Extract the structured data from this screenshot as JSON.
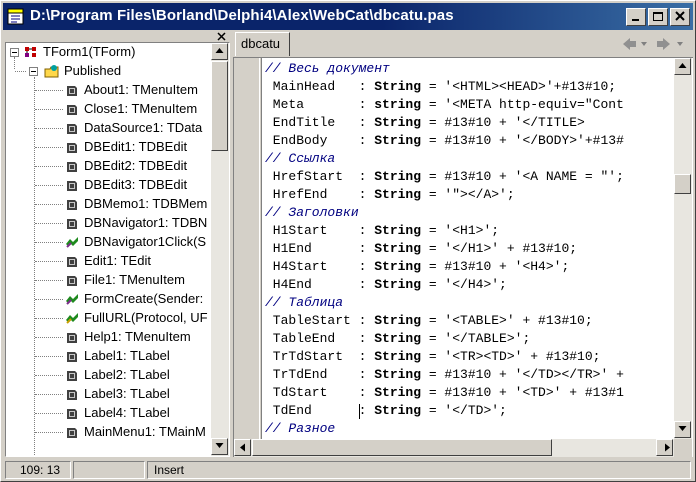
{
  "window": {
    "title": "D:\\Program Files\\Borland\\Delphi4\\Alex\\WebCat\\dbcatu.pas"
  },
  "tree": {
    "root": "TForm1(TForm)",
    "group": "Published",
    "items": [
      {
        "label": "About1: TMenuItem",
        "icon": "field-icon"
      },
      {
        "label": "Close1: TMenuItem",
        "icon": "field-icon"
      },
      {
        "label": "DataSource1: TData",
        "icon": "field-icon"
      },
      {
        "label": "DBEdit1: TDBEdit",
        "icon": "field-icon"
      },
      {
        "label": "DBEdit2: TDBEdit",
        "icon": "field-icon"
      },
      {
        "label": "DBEdit3: TDBEdit",
        "icon": "field-icon"
      },
      {
        "label": "DBMemo1: TDBMem",
        "icon": "field-icon"
      },
      {
        "label": "DBNavigator1: TDBN",
        "icon": "field-icon"
      },
      {
        "label": "DBNavigator1Click(S",
        "icon": "method-icon"
      },
      {
        "label": "Edit1: TEdit",
        "icon": "field-icon"
      },
      {
        "label": "File1: TMenuItem",
        "icon": "field-icon"
      },
      {
        "label": "FormCreate(Sender:",
        "icon": "method-icon"
      },
      {
        "label": "FullURL(Protocol, UF",
        "icon": "function-icon"
      },
      {
        "label": "Help1: TMenuItem",
        "icon": "field-icon"
      },
      {
        "label": "Label1: TLabel",
        "icon": "field-icon"
      },
      {
        "label": "Label2: TLabel",
        "icon": "field-icon"
      },
      {
        "label": "Label3: TLabel",
        "icon": "field-icon"
      },
      {
        "label": "Label4: TLabel",
        "icon": "field-icon"
      },
      {
        "label": "MainMenu1: TMainM",
        "icon": "field-icon"
      }
    ]
  },
  "editor": {
    "tab": "dbcatu",
    "lines": [
      {
        "kind": "comment",
        "text": "// Весь документ"
      },
      {
        "kind": "decl",
        "name": "MainHead  ",
        "kw": "String",
        "value": " = '<HTML><HEAD>'+#13#10;"
      },
      {
        "kind": "decl",
        "name": "Meta      ",
        "kw": "string",
        "value": " = '<META http-equiv=\"Cont"
      },
      {
        "kind": "decl",
        "name": "EndTitle  ",
        "kw": "String",
        "value": " = #13#10 + '</TITLE>"
      },
      {
        "kind": "decl",
        "name": "EndBody   ",
        "kw": "String",
        "value": " = #13#10 + '</BODY>'+#13#"
      },
      {
        "kind": "comment",
        "text": "// Ссылка"
      },
      {
        "kind": "decl",
        "name": "HrefStart ",
        "kw": "String",
        "value": " = #13#10 + '<A NAME = \"';"
      },
      {
        "kind": "decl",
        "name": "HrefEnd   ",
        "kw": "String",
        "value": " = '\"></A>';"
      },
      {
        "kind": "comment",
        "text": "// Заголовки"
      },
      {
        "kind": "decl",
        "name": "H1Start   ",
        "kw": "String",
        "value": " = '<H1>';"
      },
      {
        "kind": "decl",
        "name": "H1End     ",
        "kw": "String",
        "value": " = '</H1>' + #13#10;"
      },
      {
        "kind": "decl",
        "name": "H4Start   ",
        "kw": "String",
        "value": " = #13#10 + '<H4>';"
      },
      {
        "kind": "decl",
        "name": "H4End     ",
        "kw": "String",
        "value": " = '</H4>';"
      },
      {
        "kind": "comment",
        "text": "// Таблица"
      },
      {
        "kind": "decl",
        "name": "TableStart",
        "kw": "String",
        "value": " = '<TABLE>' + #13#10;"
      },
      {
        "kind": "decl",
        "name": "TableEnd  ",
        "kw": "String",
        "value": " = '</TABLE>';"
      },
      {
        "kind": "decl",
        "name": "TrTdStart ",
        "kw": "String",
        "value": " = '<TR><TD>' + #13#10;"
      },
      {
        "kind": "decl",
        "name": "TrTdEnd   ",
        "kw": "String",
        "value": " = #13#10 + '</TD></TR>' +"
      },
      {
        "kind": "decl",
        "name": "TdStart   ",
        "kw": "String",
        "value": " = #13#10 + '<TD>' + #13#1"
      },
      {
        "kind": "decl",
        "name": "TdEnd     ",
        "kw": "String",
        "value": " = '</TD>';"
      },
      {
        "kind": "comment",
        "text": "// Разное"
      }
    ]
  },
  "status": {
    "position": "109: 13",
    "modified": "",
    "mode": "Insert"
  },
  "colors": {
    "titlebar": "#0a246a",
    "comment": "#000080",
    "face": "#d4d0c8"
  }
}
